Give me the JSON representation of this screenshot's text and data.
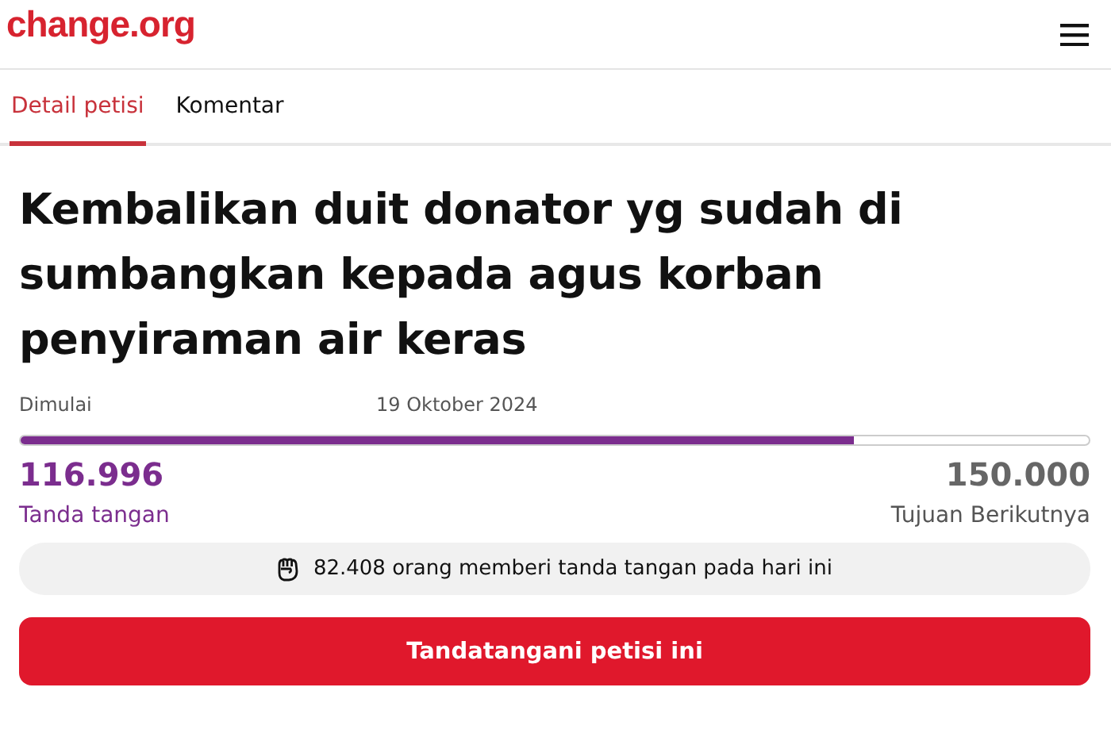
{
  "header": {
    "logo": "change.org"
  },
  "tabs": [
    {
      "label": "Detail petisi",
      "selected": true
    },
    {
      "label": "Komentar",
      "selected": false
    }
  ],
  "petition": {
    "title": "Kembalikan duit donator yg sudah di sumbangkan kepada agus korban penyiraman air keras",
    "started_label": "Dimulai",
    "started_date": "19 Oktober 2024"
  },
  "progress": {
    "level": 0.78,
    "count": "116.996",
    "count_label": "Tanda tangan",
    "goal": "150.000",
    "goal_label": "Tujuan Berikutnya"
  },
  "today_notice": "82.408 orang memberi tanda tangan pada hari ini",
  "sign_button": "Tandatangani petisi ini"
}
